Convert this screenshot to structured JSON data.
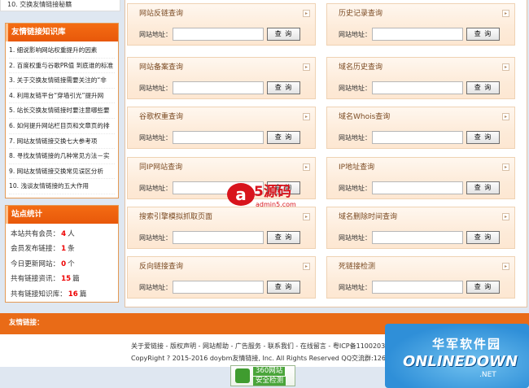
{
  "left": {
    "top_item": "10. 交换友情链接秘籍",
    "knowledge": {
      "title": "友情链接知识库",
      "items": [
        "1. 细说影响网站权重提升的因素",
        "2. 百度权重与谷歌PR值  到底谁的标准",
        "3. 关于交换友情链接需要关注的“非",
        "4. 利用友链平台“穿墙引光”提升网",
        "5. 站长交换友情链接时要注意哪些要",
        "6. 如何提升网站栏目页和文章页的排",
        "7. 网站友情链接交换七大参考项",
        "8. 寻找友情链接的几种常见方法－实",
        "9. 网站友情链接交换常见误区分析",
        "10. 浅谈友情链接的五大作用"
      ]
    },
    "stats": {
      "title": "站点统计",
      "rows": [
        {
          "label": "本站共有会员：",
          "value": "4",
          "unit": "人"
        },
        {
          "label": "会员发布链接：",
          "value": "1",
          "unit": "条"
        },
        {
          "label": "今日更新网站：",
          "value": "0",
          "unit": "个"
        },
        {
          "label": "共有链接资讯：",
          "value": "15",
          "unit": "篇"
        },
        {
          "label": "共有链接知识库：",
          "value": "16",
          "unit": "篇"
        }
      ]
    }
  },
  "tools": [
    {
      "title": "网站反链查询",
      "label": "网站地址：",
      "button": "查 询"
    },
    {
      "title": "历史记录查询",
      "label": "网站地址：",
      "button": "查 询"
    },
    {
      "title": "网站备案查询",
      "label": "网站地址：",
      "button": "查 询"
    },
    {
      "title": "域名历史查询",
      "label": "网站地址：",
      "button": "查 询"
    },
    {
      "title": "谷歌权重查询",
      "label": "网站地址：",
      "button": "查 询"
    },
    {
      "title": "域名Whois查询",
      "label": "网站地址：",
      "button": "查 询"
    },
    {
      "title": "同IP网站查询",
      "label": "网站地址：",
      "button": "查 询"
    },
    {
      "title": "IP地址查询",
      "label": "网站地址：",
      "button": "查 询"
    },
    {
      "title": "搜索引擎模拟抓取页面",
      "label": "网站地址：",
      "button": "查 询"
    },
    {
      "title": "域名删除时间查询",
      "label": "网站地址：",
      "button": "查 询"
    },
    {
      "title": "反向链接查询",
      "label": "网站地址：",
      "button": "查 询"
    },
    {
      "title": "死链接检测",
      "label": "网站地址：",
      "button": "查 询"
    }
  ],
  "watermark": {
    "logo": "a5源码",
    "sub": "admin5.com"
  },
  "footer": {
    "bar_title": "友情链接：",
    "links": "关于爱链接 - 版权声明 - 网站帮助 - 广告服务 - 联系我们 - 在线留言 - 粤ICP备1100203",
    "copyright": "CopyRight ? 2015-2016 doybm友情链接, Inc. All Rights Reserved QQ交流群:1267444",
    "badge_line1": "360网站",
    "badge_line2": "安全检测"
  },
  "onlinedown": {
    "cn": "华军软件园",
    "en": "ONLINEDOWN",
    "tld": ".NET"
  },
  "colors": {
    "accent": "#e96b17",
    "stat_value": "#e00000",
    "page_bg": "#dfe7f1"
  }
}
